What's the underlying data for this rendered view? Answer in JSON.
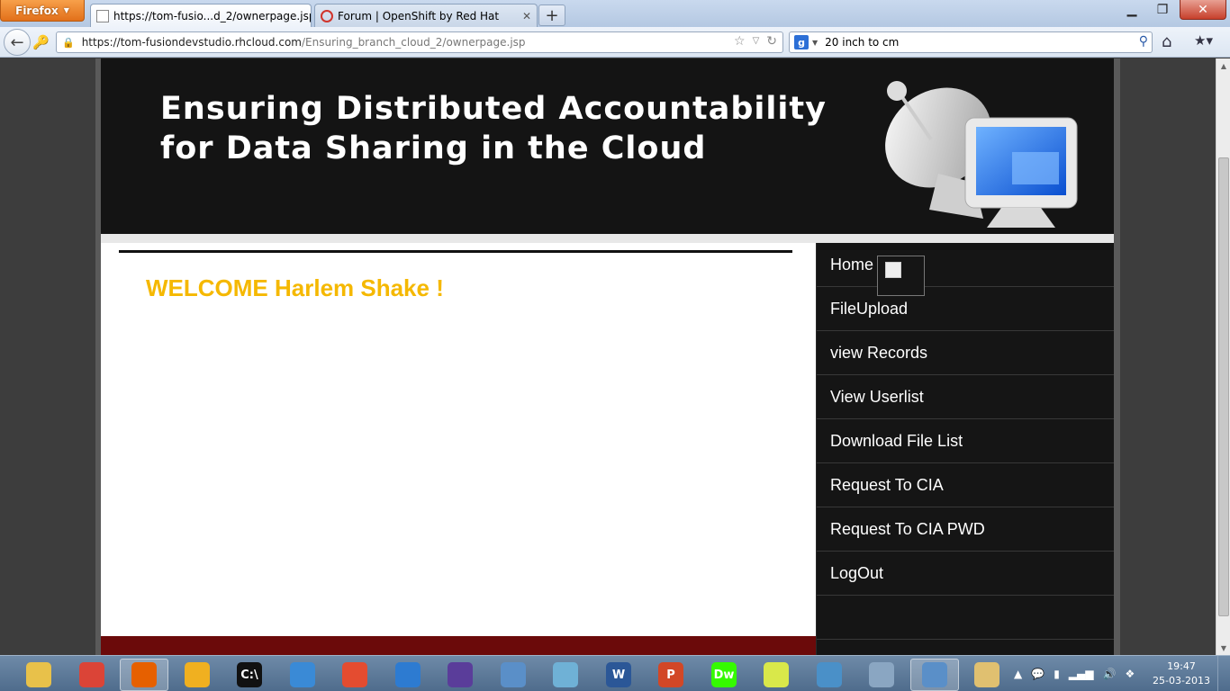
{
  "browser": {
    "menu_button": "Firefox",
    "tabs": [
      {
        "title": "https://tom-fusio...d_2/ownerpage.jsp",
        "active": true
      },
      {
        "title": "Forum | OpenShift by Red Hat",
        "active": false
      }
    ],
    "url_host": "https://tom-fusiondevstudio.rhcloud.com",
    "url_path": "/Ensuring_branch_cloud_2/ownerpage.jsp",
    "search_query": "20 inch to cm"
  },
  "page": {
    "header_line1": "Ensuring Distributed Accountability",
    "header_line2": "for Data Sharing in the Cloud",
    "welcome": "WELCOME Harlem Shake !",
    "menu": [
      "Home",
      "FileUpload",
      "view Records",
      "View Userlist",
      "Download File List",
      "Request To CIA",
      "Request To CIA PWD",
      "LogOut"
    ],
    "colors": {
      "welcome": "#f5b800",
      "header_bg": "#141414",
      "sidebar_bg": "#151515",
      "footer_bar": "#6b0a0a"
    }
  },
  "taskbar": {
    "apps": [
      {
        "name": "file-explorer-icon",
        "color": "#e8c14a",
        "label": ""
      },
      {
        "name": "chrome-icon",
        "color": "#db4437",
        "label": ""
      },
      {
        "name": "firefox-icon",
        "color": "#e66000",
        "label": "",
        "active": true
      },
      {
        "name": "puzzle-app-icon",
        "color": "#f0b020",
        "label": ""
      },
      {
        "name": "command-prompt-icon",
        "color": "#111111",
        "label": "C:\\"
      },
      {
        "name": "messenger-icon",
        "color": "#3a8ad6",
        "label": ""
      },
      {
        "name": "git-icon",
        "color": "#e44c30",
        "label": ""
      },
      {
        "name": "itunes-icon",
        "color": "#2d7bd1",
        "label": ""
      },
      {
        "name": "eclipse-icon",
        "color": "#5a3d9a",
        "label": ""
      },
      {
        "name": "virtualbox-icon",
        "color": "#5a8fc8",
        "label": ""
      },
      {
        "name": "notes-icon",
        "color": "#6fb1d6",
        "label": ""
      },
      {
        "name": "word-icon",
        "color": "#2b5797",
        "label": "W"
      },
      {
        "name": "powerpoint-icon",
        "color": "#d24726",
        "label": "P"
      },
      {
        "name": "dreamweaver-icon",
        "color": "#35fa00",
        "label": "Dw"
      },
      {
        "name": "sticky-notes-icon",
        "color": "#d9e84a",
        "label": ""
      },
      {
        "name": "control-panel-icon",
        "color": "#4a90c8",
        "label": ""
      },
      {
        "name": "resource-monitor-icon",
        "color": "#8aa6c2",
        "label": ""
      },
      {
        "name": "virtualbox-2-icon",
        "color": "#5a8fc8",
        "label": "",
        "active": true
      },
      {
        "name": "paint-icon",
        "color": "#e0c070",
        "label": ""
      }
    ],
    "time": "19:47",
    "date": "25-03-2013"
  }
}
